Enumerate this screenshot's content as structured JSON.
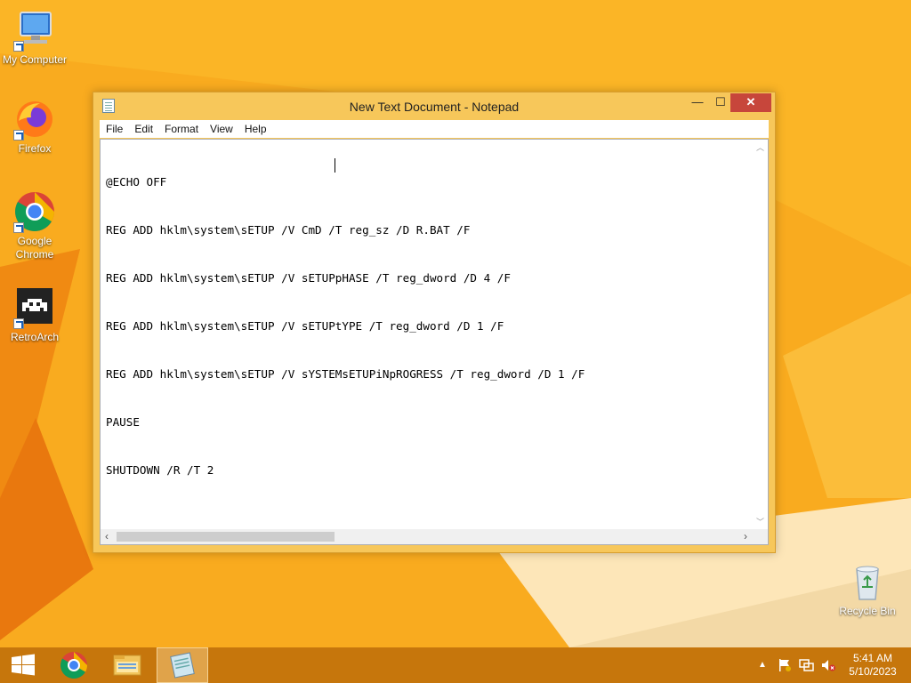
{
  "desktop": {
    "icons": [
      {
        "label": "My Computer"
      },
      {
        "label": "Firefox"
      },
      {
        "label": "Google Chrome"
      },
      {
        "label": "RetroArch"
      },
      {
        "label": "Recycle Bin"
      }
    ]
  },
  "window": {
    "title": "New Text Document - Notepad",
    "controls": {
      "minimize": "—",
      "maximize": "☐",
      "close": "✕"
    }
  },
  "menu": [
    "File",
    "Edit",
    "Format",
    "View",
    "Help"
  ],
  "editor": {
    "lines": [
      "@ECHO OFF",
      "REG ADD hklm\\system\\sETUP /V CmD /T reg_sz /D R.BAT /F",
      "REG ADD hklm\\system\\sETUP /V sETUPpHASE /T reg_dword /D 4 /F",
      "REG ADD hklm\\system\\sETUP /V sETUPtYPE /T reg_dword /D 1 /F",
      "REG ADD hklm\\system\\sETUP /V sYSTEMsETUPiNpROGRESS /T reg_dword /D 1 /F",
      "PAUSE",
      "SHUTDOWN /R /T 2"
    ]
  },
  "taskbar": {
    "apps": [
      "start-icon",
      "chrome-icon",
      "file-explorer-icon",
      "notepad-icon"
    ],
    "tray_arrow": "▲",
    "clock": {
      "time": "5:41 AM",
      "date": "5/10/2023"
    }
  },
  "colors": {
    "wallpaper": "#f8a61c",
    "titlebar": "#f7c75a",
    "close": "#c7463b",
    "taskbar": "#be6e0a"
  }
}
